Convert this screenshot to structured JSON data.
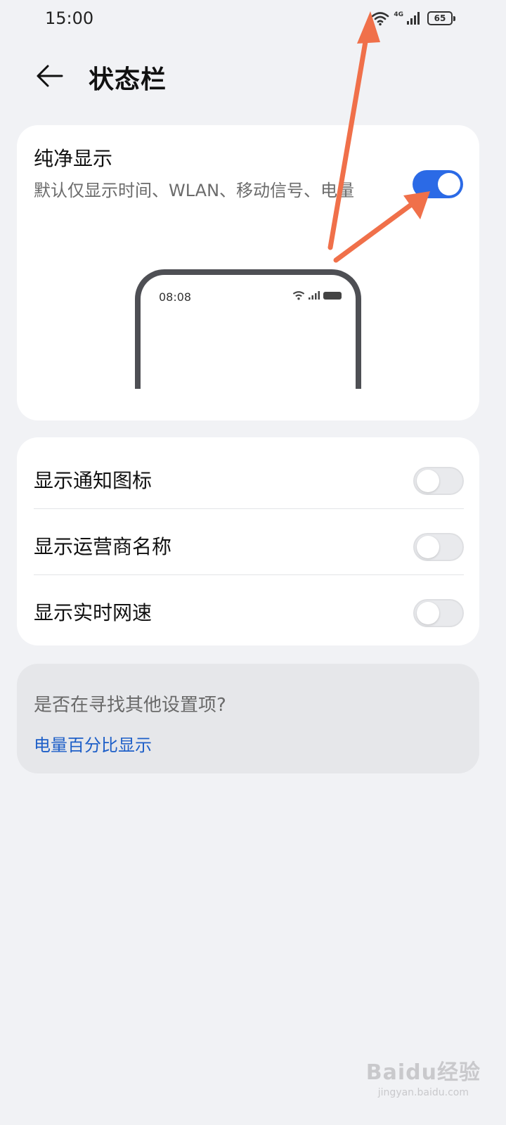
{
  "status_bar": {
    "time": "15:00",
    "network": "4G",
    "battery": "65"
  },
  "header": {
    "title": "状态栏"
  },
  "pure_display": {
    "title": "纯净显示",
    "subtitle": "默认仅显示时间、WLAN、移动信号、电量",
    "toggle_on": true,
    "preview_time": "08:08"
  },
  "options": [
    {
      "label": "显示通知图标",
      "toggle_on": false
    },
    {
      "label": "显示运营商名称",
      "toggle_on": false
    },
    {
      "label": "显示实时网速",
      "toggle_on": false
    }
  ],
  "suggestion": {
    "question": "是否在寻找其他设置项?",
    "link": "电量百分比显示"
  },
  "watermark": {
    "main": "Baidu经验",
    "sub": "jingyan.baidu.com"
  },
  "colors": {
    "accent": "#2b6ae6",
    "annotation_arrow": "#f0704a",
    "link": "#1e5fc8"
  }
}
